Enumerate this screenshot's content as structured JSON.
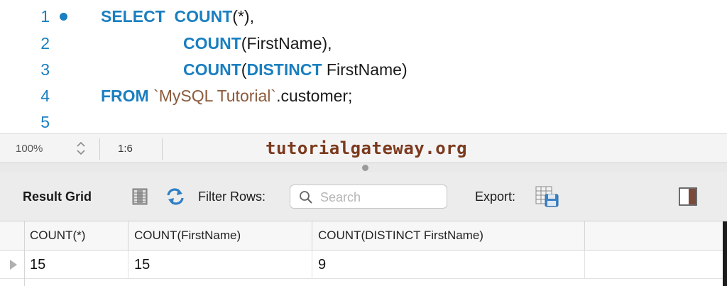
{
  "editor": {
    "lines": [
      {
        "number": "1",
        "parts": [
          {
            "t": "SELECT",
            "k": "kw"
          },
          {
            "t": "  ",
            "k": ""
          },
          {
            "t": "COUNT",
            "k": "kw"
          },
          {
            "t": "(*),",
            "k": ""
          }
        ]
      },
      {
        "number": "2",
        "parts": [
          {
            "t": "COUNT",
            "k": "kw"
          },
          {
            "t": "(FirstName),",
            "k": ""
          }
        ]
      },
      {
        "number": "3",
        "parts": [
          {
            "t": "COUNT",
            "k": "kw"
          },
          {
            "t": "(",
            "k": ""
          },
          {
            "t": "DISTINCT",
            "k": "kw"
          },
          {
            "t": " FirstName)",
            "k": ""
          }
        ]
      },
      {
        "number": "4",
        "parts": [
          {
            "t": "FROM",
            "k": "kw"
          },
          {
            "t": " ",
            "k": ""
          },
          {
            "t": "`MySQL Tutorial`",
            "k": "str"
          },
          {
            "t": ".customer;",
            "k": ""
          }
        ]
      },
      {
        "number": "5",
        "parts": []
      }
    ]
  },
  "status": {
    "zoom": "100%",
    "cursor_position": "1:6",
    "watermark": "tutorialgateway.org"
  },
  "toolbar": {
    "title": "Result Grid",
    "filter_label": "Filter Rows:",
    "search_placeholder": "Search",
    "export_label": "Export:"
  },
  "grid": {
    "columns": [
      "COUNT(*)",
      "COUNT(FirstName)",
      "COUNT(DISTINCT FirstName)"
    ],
    "rows": [
      [
        "15",
        "15",
        "9"
      ]
    ]
  },
  "colors": {
    "keyword": "#1a7fc0",
    "string": "#8b5a3c",
    "watermark": "#7b3a1e"
  },
  "icons": [
    "breakpoint-dot",
    "zoom-stepper-icon",
    "grid-view-icon",
    "refresh-icon",
    "search-icon",
    "export-icon",
    "panel-toggle-icon",
    "row-pointer-icon"
  ]
}
